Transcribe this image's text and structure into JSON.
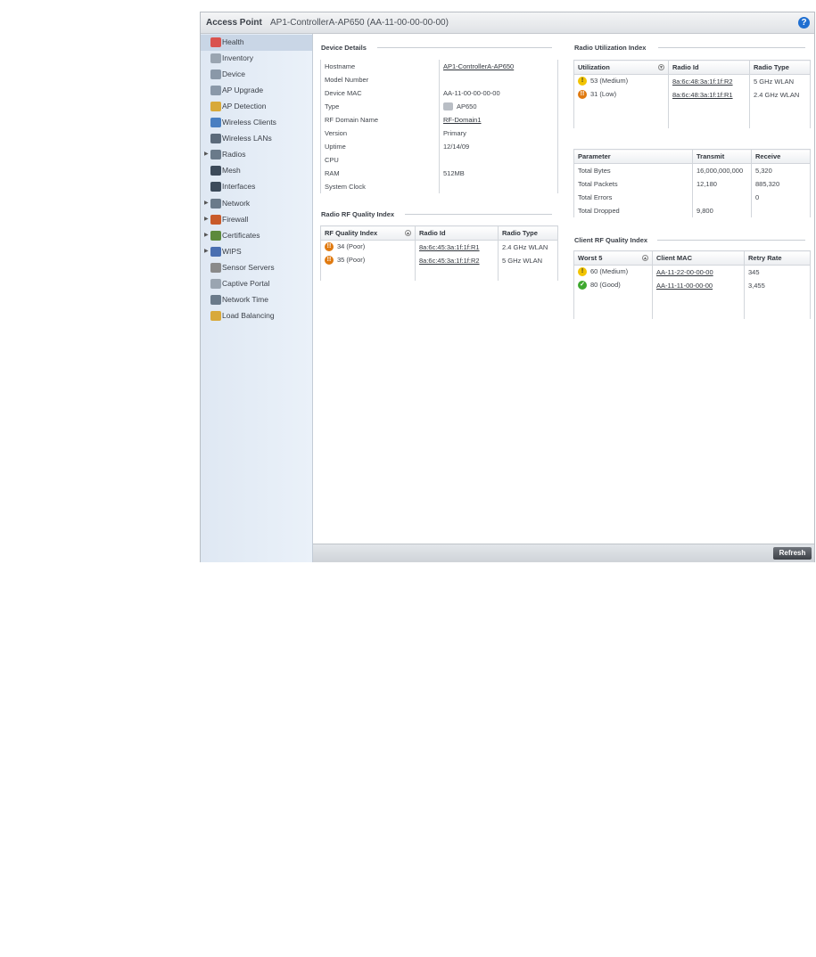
{
  "titlebar": {
    "title": "Access Point",
    "subtitle": "AP1-ControllerA-AP650 (AA-11-00-00-00-00)",
    "help": "?"
  },
  "sidebar": {
    "items": [
      {
        "label": "Health",
        "icon": "health-icon",
        "expandable": false,
        "active": true
      },
      {
        "label": "Inventory",
        "icon": "inventory-icon",
        "expandable": false
      },
      {
        "label": "Device",
        "icon": "device-icon",
        "expandable": false
      },
      {
        "label": "AP Upgrade",
        "icon": "ap-upgrade-icon",
        "expandable": false
      },
      {
        "label": "AP Detection",
        "icon": "ap-detection-icon",
        "expandable": false
      },
      {
        "label": "Wireless Clients",
        "icon": "wireless-clients-icon",
        "expandable": false
      },
      {
        "label": "Wireless LANs",
        "icon": "wireless-lans-icon",
        "expandable": false
      },
      {
        "label": "Radios",
        "icon": "radios-icon",
        "expandable": true
      },
      {
        "label": "Mesh",
        "icon": "mesh-icon",
        "expandable": false
      },
      {
        "label": "Interfaces",
        "icon": "interfaces-icon",
        "expandable": false
      },
      {
        "label": "Network",
        "icon": "network-icon",
        "expandable": true
      },
      {
        "label": "Firewall",
        "icon": "firewall-icon",
        "expandable": true
      },
      {
        "label": "Certificates",
        "icon": "certificates-icon",
        "expandable": true
      },
      {
        "label": "WIPS",
        "icon": "wips-icon",
        "expandable": true
      },
      {
        "label": "Sensor Servers",
        "icon": "sensor-servers-icon",
        "expandable": false
      },
      {
        "label": "Captive Portal",
        "icon": "captive-portal-icon",
        "expandable": false
      },
      {
        "label": "Network Time",
        "icon": "network-time-icon",
        "expandable": false
      },
      {
        "label": "Load Balancing",
        "icon": "load-balancing-icon",
        "expandable": false
      }
    ]
  },
  "device_details": {
    "title": "Device Details",
    "rows": [
      {
        "label": "Hostname",
        "value": "AP1-ControllerA-AP650",
        "link": true
      },
      {
        "label": "Model Number",
        "value": ""
      },
      {
        "label": "Device MAC",
        "value": "AA-11-00-00-00-00"
      },
      {
        "label": "Type",
        "value": "AP650",
        "icon": "access-point-icon"
      },
      {
        "label": "RF Domain Name",
        "value": "RF-Domain1",
        "link": true
      },
      {
        "label": "Version",
        "value": "Primary"
      },
      {
        "label": "Uptime",
        "value": "12/14/09"
      },
      {
        "label": "CPU",
        "value": ""
      },
      {
        "label": "RAM",
        "value": "512MB"
      },
      {
        "label": "System Clock",
        "value": ""
      }
    ]
  },
  "radio_rf_quality": {
    "title": "Radio RF Quality Index",
    "columns": [
      "RF Quality Index",
      "Radio Id",
      "Radio Type"
    ],
    "rows": [
      {
        "index": "34 (Poor)",
        "status": "poor",
        "radio_id": "8a:6c:45:3a:1f:1f:R1",
        "type": "2.4 GHz WLAN"
      },
      {
        "index": "35 (Poor)",
        "status": "poor",
        "radio_id": "8a:6c:45:3a:1f:1f:R2",
        "type": "5 GHz WLAN"
      }
    ]
  },
  "radio_utilization": {
    "title": "Radio Utilization Index",
    "columns": [
      "Utilization",
      "Radio Id",
      "Radio Type"
    ],
    "rows": [
      {
        "util": "53 (Medium)",
        "status": "warn",
        "radio_id": "8a:6c:48:3a:1f:1f:R2",
        "type": "5 GHz WLAN"
      },
      {
        "util": "31 (Low)",
        "status": "poor",
        "radio_id": "8a:6c:48:3a:1f:1f:R1",
        "type": "2.4 GHz WLAN"
      }
    ]
  },
  "traffic": {
    "columns": [
      "Parameter",
      "Transmit",
      "Receive"
    ],
    "rows": [
      {
        "param": "Total Bytes",
        "tx": "16,000,000,000",
        "rx": "5,320"
      },
      {
        "param": "Total Packets",
        "tx": "12,180",
        "rx": "885,320"
      },
      {
        "param": "Total Errors",
        "tx": "",
        "rx": "0"
      },
      {
        "param": "Total Dropped",
        "tx": "9,800",
        "rx": ""
      }
    ]
  },
  "client_rf_quality": {
    "title": "Client RF Quality Index",
    "columns": [
      "Worst 5",
      "Client MAC",
      "Retry Rate"
    ],
    "rows": [
      {
        "worst": "60 (Medium)",
        "status": "warn",
        "mac": "AA-11-22-00-00-00",
        "retry": "345"
      },
      {
        "worst": "80 (Good)",
        "status": "good",
        "mac": "AA-11-11-00-00-00",
        "retry": "3,455"
      }
    ]
  },
  "footer": {
    "refresh_label": "Refresh"
  },
  "colors": {
    "accent": "#1f6fd1",
    "sidebar_bg": "#e3ebf5",
    "warn": "#f2c400",
    "poor": "#e07a10",
    "good": "#3ea82f"
  }
}
